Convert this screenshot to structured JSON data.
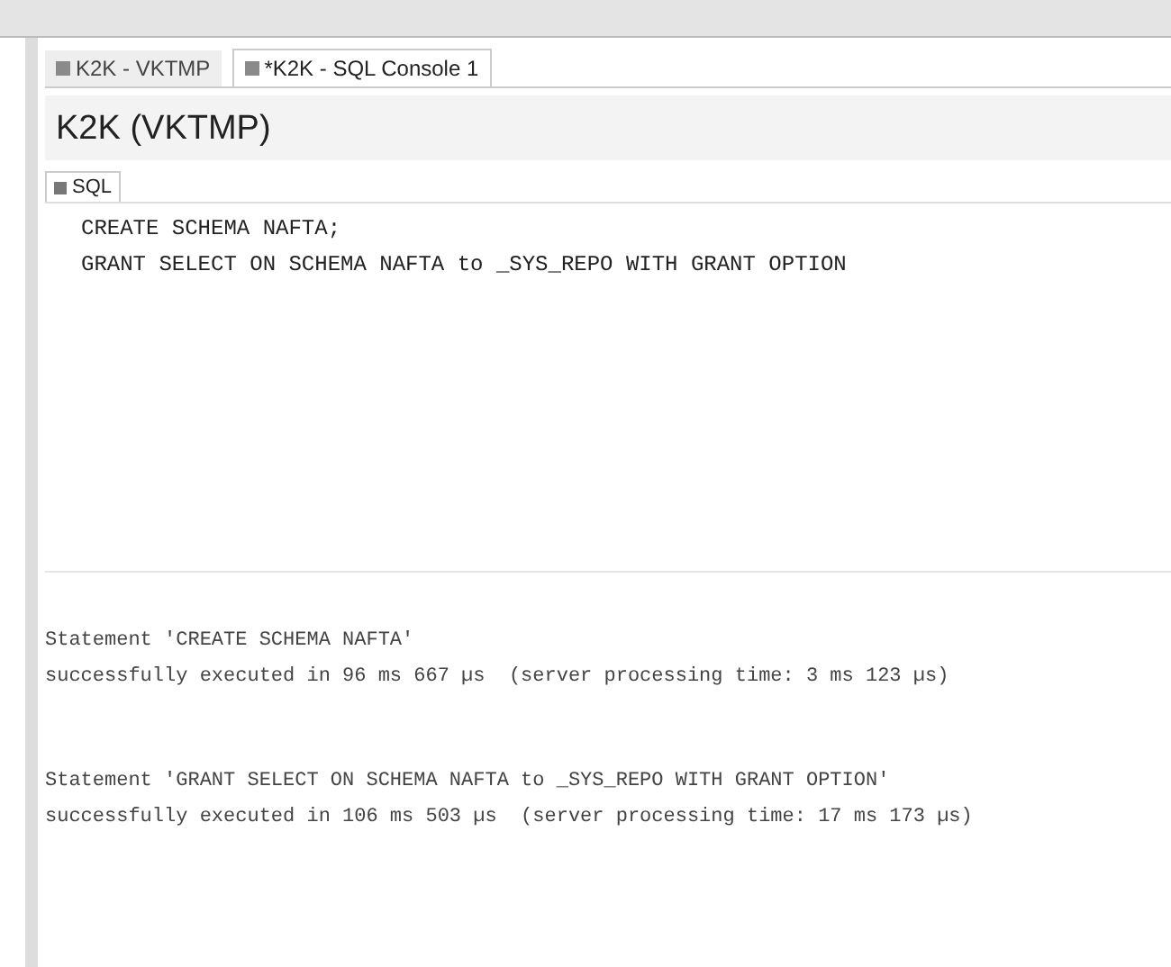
{
  "tabs": [
    {
      "label": "K2K - VKTMP",
      "selected": false
    },
    {
      "label": "*K2K - SQL Console 1",
      "selected": true
    }
  ],
  "title": "K2K (VKTMP)",
  "subtabs": [
    {
      "label": "SQL",
      "selected": true
    }
  ],
  "editor": {
    "lines": [
      "CREATE SCHEMA NAFTA;",
      "GRANT SELECT ON SCHEMA NAFTA to _SYS_REPO WITH GRANT OPTION"
    ]
  },
  "results": [
    {
      "statement": "Statement 'CREATE SCHEMA NAFTA'",
      "message": "successfully executed in 96 ms 667 µs  (server processing time: 3 ms 123 µs)"
    },
    {
      "statement": "Statement 'GRANT SELECT ON SCHEMA NAFTA to _SYS_REPO WITH GRANT OPTION'",
      "message": "successfully executed in 106 ms 503 µs  (server processing time: 17 ms 173 µs)"
    }
  ]
}
